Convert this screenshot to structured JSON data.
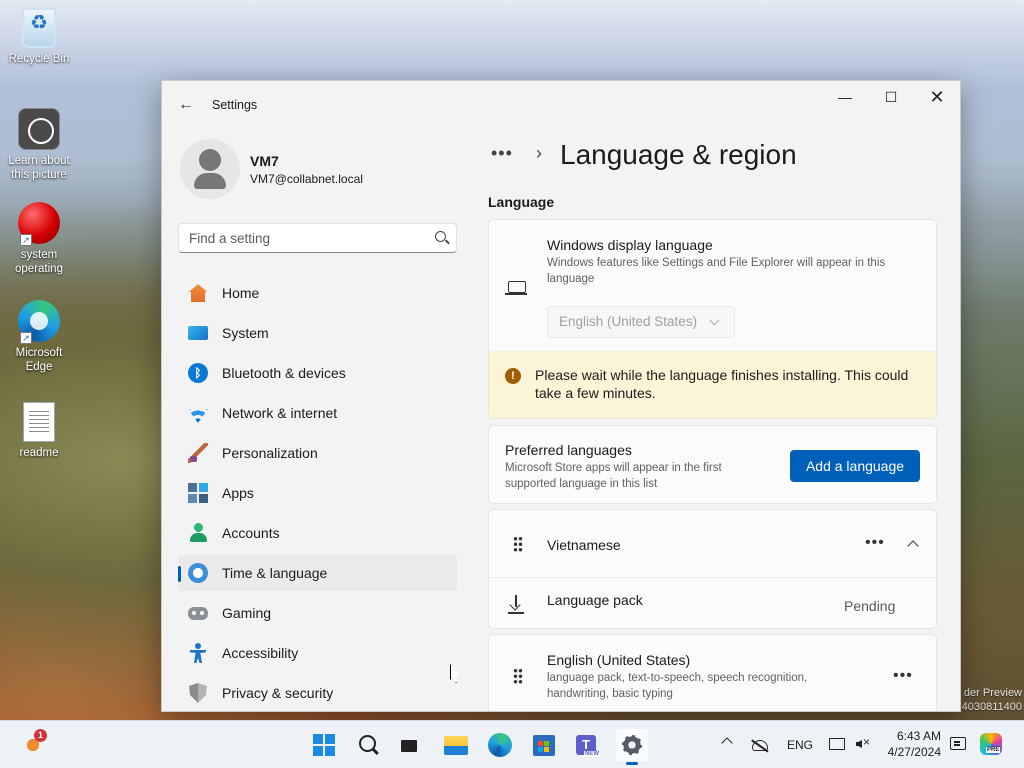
{
  "desktop": {
    "icons": [
      {
        "label": "Recycle Bin",
        "icon": "recycle-bin-icon"
      },
      {
        "label": "Learn about this picture",
        "icon": "learn-picture-icon"
      },
      {
        "label": "system operating",
        "icon": "red-ball-icon"
      },
      {
        "label": "Microsoft Edge",
        "icon": "edge-icon"
      },
      {
        "label": "readme",
        "icon": "text-file-icon"
      }
    ],
    "watermark": {
      "line1": "der Preview",
      "line2": "4030811400"
    }
  },
  "window": {
    "app_title": "Settings",
    "profile": {
      "name": "VM7",
      "email": "VM7@collabnet.local"
    },
    "search": {
      "placeholder": "Find a setting"
    },
    "nav": [
      {
        "label": "Home",
        "icon": "home-icon"
      },
      {
        "label": "System",
        "icon": "system-icon"
      },
      {
        "label": "Bluetooth & devices",
        "icon": "bluetooth-icon"
      },
      {
        "label": "Network & internet",
        "icon": "network-icon"
      },
      {
        "label": "Personalization",
        "icon": "personalization-icon"
      },
      {
        "label": "Apps",
        "icon": "apps-icon"
      },
      {
        "label": "Accounts",
        "icon": "accounts-icon"
      },
      {
        "label": "Time & language",
        "icon": "time-language-icon",
        "active": true
      },
      {
        "label": "Gaming",
        "icon": "gaming-icon"
      },
      {
        "label": "Accessibility",
        "icon": "accessibility-icon"
      },
      {
        "label": "Privacy & security",
        "icon": "privacy-icon"
      }
    ],
    "page": {
      "breadcrumb_more": "•••",
      "title": "Language & region",
      "section_language": "Language",
      "display_language": {
        "title": "Windows display language",
        "description": "Windows features like Settings and File Explorer will appear in this language",
        "selected": "English (United States)"
      },
      "warning": "Please wait while the language finishes installing. This could take a few minutes.",
      "preferred": {
        "title": "Preferred languages",
        "description": "Microsoft Store apps will appear in the first supported language in this list",
        "add_button": "Add a language"
      },
      "languages": [
        {
          "name": "Vietnamese",
          "more": "•••",
          "sub": {
            "name": "Language pack",
            "status": "Pending"
          }
        },
        {
          "name": "English (United States)",
          "description": "language pack, text-to-speech, speech recognition, handwriting, basic typing",
          "more": "•••"
        }
      ]
    }
  },
  "taskbar": {
    "widgets_badge": "1",
    "language": "ENG",
    "time": "6:43 AM",
    "date": "4/27/2024"
  },
  "colors": {
    "accent": "#005fb8",
    "warning_bg": "#fcf4d6",
    "warning_icon": "#9d5d00"
  }
}
